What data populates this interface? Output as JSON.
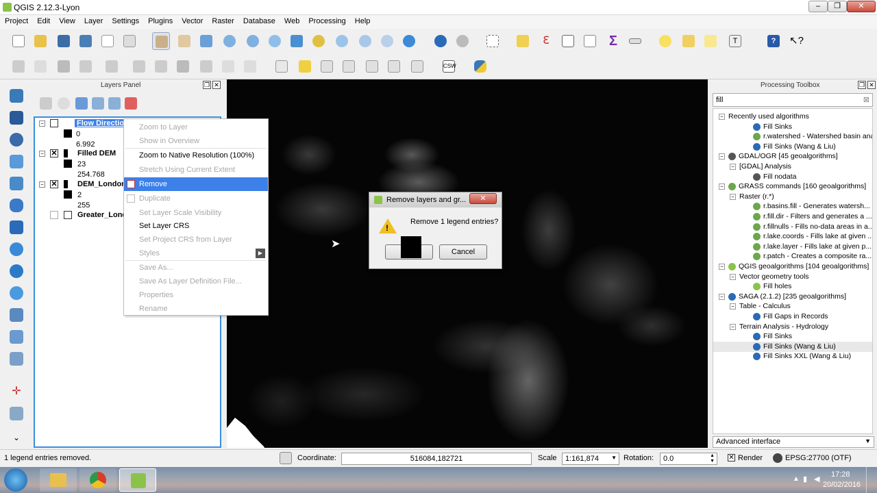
{
  "window": {
    "title": "QGIS 2.12.3-Lyon",
    "controls": [
      "–",
      "❐",
      "✕"
    ]
  },
  "menu": [
    "Project",
    "Edit",
    "View",
    "Layer",
    "Settings",
    "Plugins",
    "Vector",
    "Raster",
    "Database",
    "Web",
    "Processing",
    "Help"
  ],
  "layers_panel": {
    "title": "Layers Panel",
    "layers": [
      {
        "name": "Flow Direction",
        "checked": false,
        "min": "0",
        "max": "6.992"
      },
      {
        "name": "Filled DEM",
        "checked": true,
        "min": "23",
        "max": "254.768"
      },
      {
        "name": "DEM_London",
        "checked": true,
        "min": "2",
        "max": "255"
      },
      {
        "name": "Greater_London",
        "checked": false
      }
    ]
  },
  "context_menu": {
    "items": [
      {
        "label": "Zoom to Layer",
        "enabled": false
      },
      {
        "label": "Show in Overview",
        "enabled": false
      },
      {
        "label": "Zoom to Native Resolution (100%)",
        "enabled": true
      },
      {
        "label": "Stretch Using Current Extent",
        "enabled": false
      },
      {
        "label": "Remove",
        "enabled": true,
        "selected": true
      },
      {
        "label": "Duplicate",
        "enabled": false
      },
      {
        "label": "Set Layer Scale Visibility",
        "enabled": false
      },
      {
        "label": "Set Layer CRS",
        "enabled": true
      },
      {
        "label": "Set Project CRS from Layer",
        "enabled": false
      },
      {
        "label": "Styles",
        "enabled": false
      },
      {
        "label": "Save As...",
        "enabled": false
      },
      {
        "label": "Save As Layer Definition File...",
        "enabled": false
      },
      {
        "label": "Properties",
        "enabled": false
      },
      {
        "label": "Rename",
        "enabled": false
      }
    ]
  },
  "dialog": {
    "title": "Remove layers and gr...",
    "message": "Remove 1 legend entries?",
    "ok_label": "OK",
    "cancel_label": "Cancel"
  },
  "toolbox": {
    "title": "Processing Toolbox",
    "search_value": "fill",
    "tree": [
      {
        "label": "Recently used algorithms",
        "level": 0,
        "expander": "⊟"
      },
      {
        "label": "Fill Sinks",
        "level": 2,
        "icon": "saga"
      },
      {
        "label": "r.watershed - Watershed basin analy...",
        "level": 2,
        "icon": "grass"
      },
      {
        "label": "Fill Sinks (Wang & Liu)",
        "level": 2,
        "icon": "saga"
      },
      {
        "label": "GDAL/OGR [45 geoalgorithms]",
        "level": 0,
        "expander": "⊟",
        "icon": "gdal"
      },
      {
        "label": "[GDAL] Analysis",
        "level": 1,
        "expander": "⊟"
      },
      {
        "label": "Fill nodata",
        "level": 2,
        "icon": "gdal"
      },
      {
        "label": "GRASS commands [160 geoalgorithms]",
        "level": 0,
        "expander": "⊟",
        "icon": "grass"
      },
      {
        "label": "Raster (r.*)",
        "level": 1,
        "expander": "⊟"
      },
      {
        "label": "r.basins.fill - Generates watersh...",
        "level": 2,
        "icon": "grass"
      },
      {
        "label": "r.fill.dir - Filters and generates a ...",
        "level": 2,
        "icon": "grass"
      },
      {
        "label": "r.fillnulls - Fills no-data areas in a...",
        "level": 2,
        "icon": "grass"
      },
      {
        "label": "r.lake.coords - Fills lake at given ...",
        "level": 2,
        "icon": "grass"
      },
      {
        "label": "r.lake.layer - Fills lake at given p...",
        "level": 2,
        "icon": "grass"
      },
      {
        "label": "r.patch - Creates a composite ra...",
        "level": 2,
        "icon": "grass"
      },
      {
        "label": "QGIS geoalgorithms [104 geoalgorithms]",
        "level": 0,
        "expander": "⊟",
        "icon": "qgis"
      },
      {
        "label": "Vector geometry tools",
        "level": 1,
        "expander": "⊟"
      },
      {
        "label": "Fill holes",
        "level": 2,
        "icon": "qgis"
      },
      {
        "label": "SAGA (2.1.2) [235 geoalgorithms]",
        "level": 0,
        "expander": "⊟",
        "icon": "saga"
      },
      {
        "label": "Table - Calculus",
        "level": 1,
        "expander": "⊟"
      },
      {
        "label": "Fill Gaps in Records",
        "level": 2,
        "icon": "saga"
      },
      {
        "label": "Terrain Analysis - Hydrology",
        "level": 1,
        "expander": "⊟"
      },
      {
        "label": "Fill Sinks",
        "level": 2,
        "icon": "saga"
      },
      {
        "label": "Fill Sinks (Wang & Liu)",
        "level": 2,
        "icon": "saga",
        "highlight": true
      },
      {
        "label": "Fill Sinks XXL (Wang & Liu)",
        "level": 2,
        "icon": "saga"
      }
    ],
    "mode": "Advanced interface"
  },
  "status": {
    "message": "1 legend entries removed.",
    "coordinate_label": "Coordinate:",
    "coordinate_value": "516084,182721",
    "scale_label": "Scale",
    "scale_value": "1:161,874",
    "rotation_label": "Rotation:",
    "rotation_value": "0.0",
    "render_label": "Render",
    "crs": "EPSG:27700 (OTF)"
  },
  "taskbar": {
    "time": "17:28",
    "date": "20/02/2016"
  },
  "colors": {
    "selection": "#3c80e8",
    "panel_border": "#3b8ee0",
    "map_bg": "#050505"
  }
}
